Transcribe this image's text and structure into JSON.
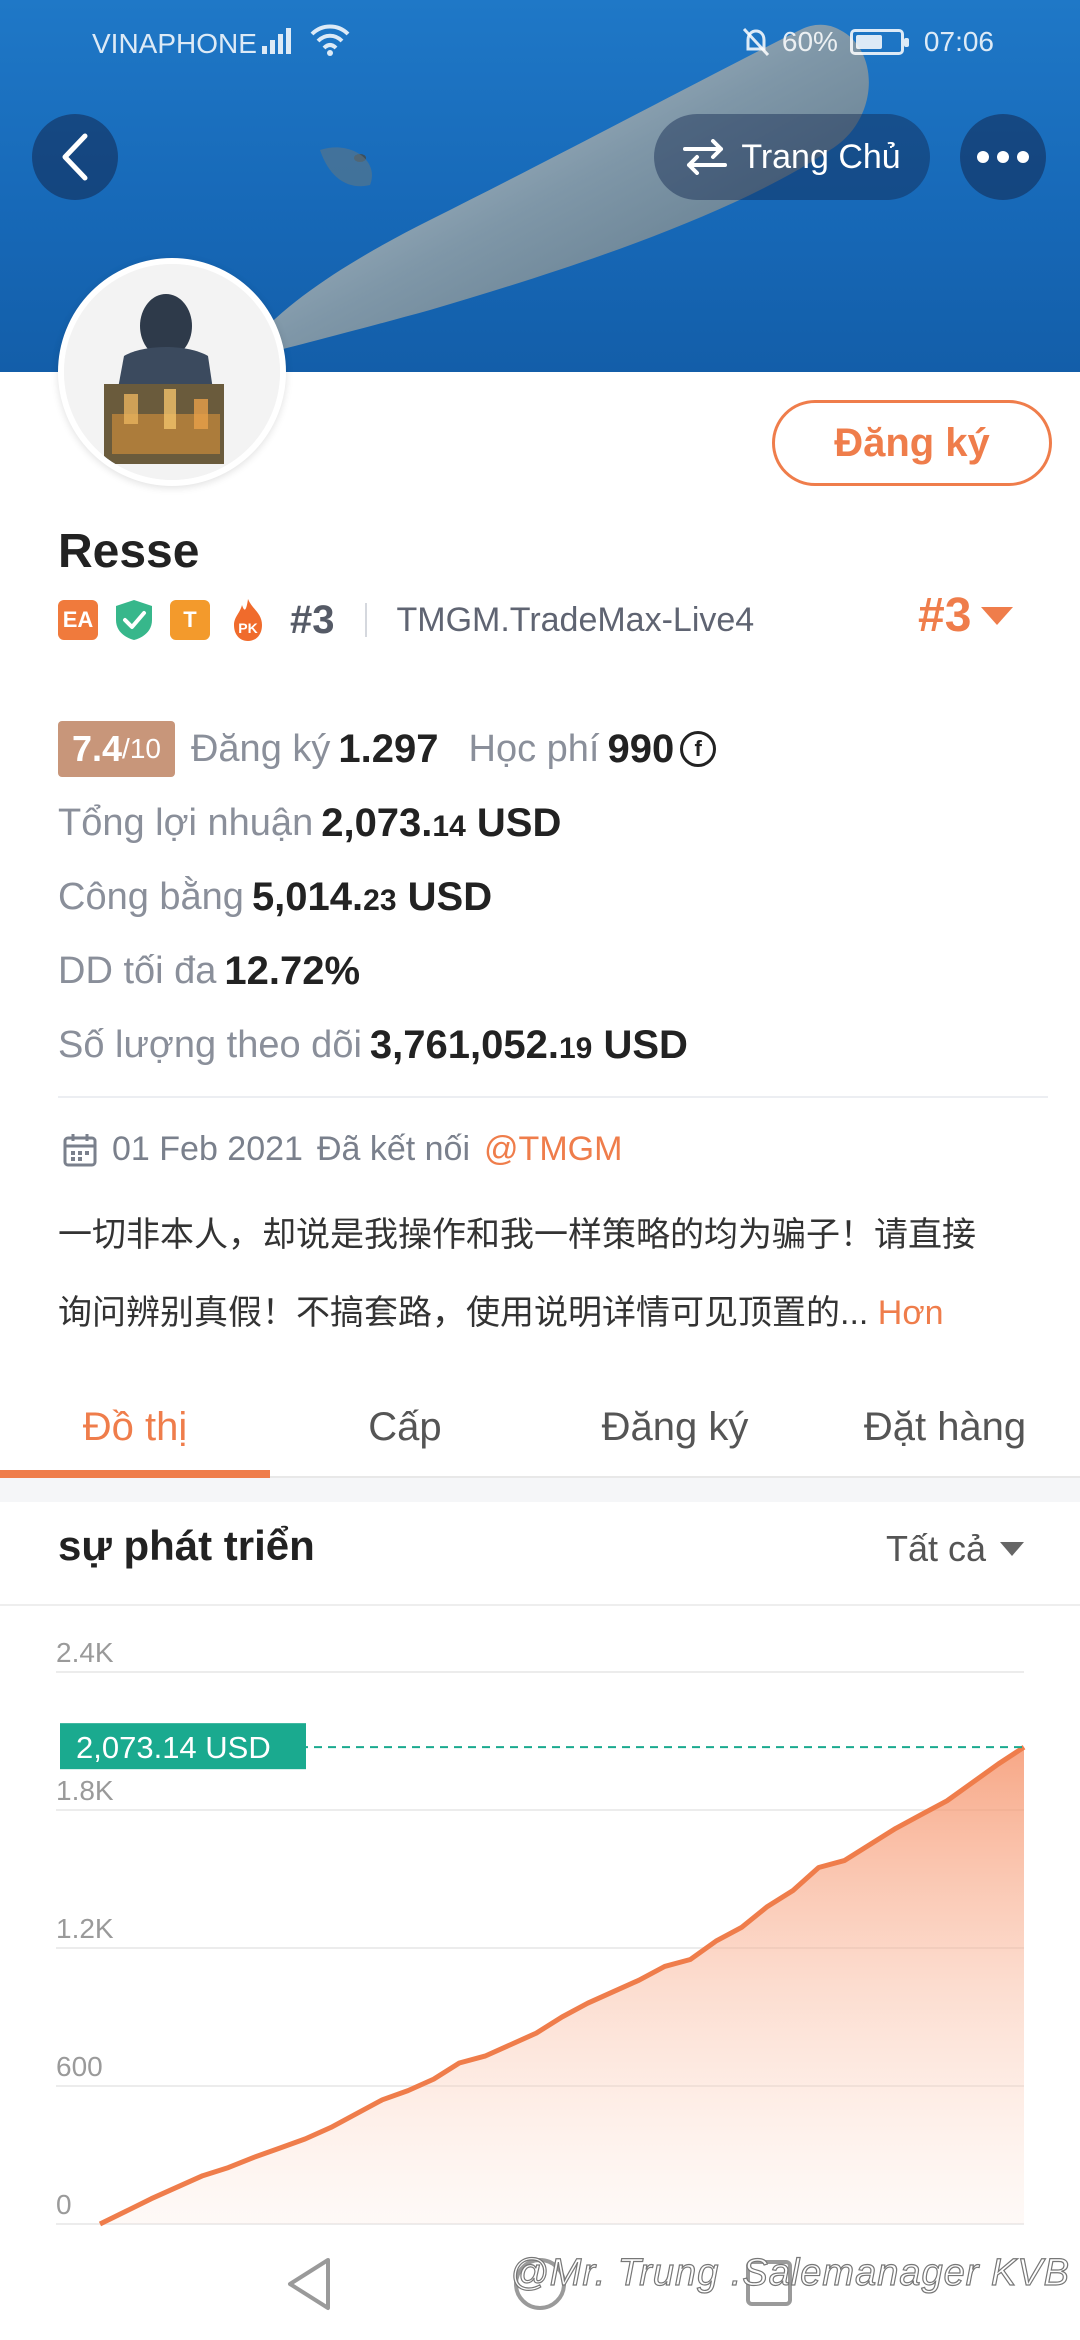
{
  "status_bar": {
    "carrier": "VINAPHONE",
    "battery": "60%",
    "time": "07:06"
  },
  "header": {
    "home_label": "Trang Chủ",
    "subscribe_label": "Đăng ký"
  },
  "profile": {
    "name": "Resse",
    "badges": [
      "EA",
      "T",
      "PK"
    ],
    "rank": "#3",
    "server": "TMGM.TradeMax-Live4",
    "rank_right": "#3"
  },
  "stats": {
    "score_main": "7.4",
    "score_suffix": "/10",
    "subscribers_label": "Đăng ký",
    "subscribers_value": "1.297",
    "fee_label": "Học phí",
    "fee_value": "990",
    "fee_currency_symbol": "f",
    "profit_label": "Tổng lợi nhuận",
    "profit_int": "2,073.",
    "profit_dec": "14",
    "profit_unit": "USD",
    "equity_label": "Công bằng",
    "equity_int": "5,014.",
    "equity_dec": "23",
    "equity_unit": "USD",
    "dd_label": "DD tối đa",
    "dd_value": "12.72%",
    "follow_label": "Số lượng theo dõi",
    "follow_int": "3,761,052.",
    "follow_dec": "19",
    "follow_unit": "USD"
  },
  "connection": {
    "date": "01 Feb 2021",
    "text": "Đã kết nối",
    "handle": "@TMGM"
  },
  "bio": {
    "line1": "一切非本人，却说是我操作和我一样策略的均为骗子！请直接",
    "line2": "询问辨别真假！不搞套路，使用说明详情可见顶置的...",
    "more": "Hơn"
  },
  "tabs": [
    "Đồ thị",
    "Cấp",
    "Đăng ký",
    "Đặt hàng"
  ],
  "chart_section": {
    "title": "sự phát triển",
    "filter": "Tất cả"
  },
  "colors": {
    "accent": "#ef7d4b",
    "teal": "#1aaa8f",
    "banner": "#1769b8"
  },
  "chart_data": {
    "type": "area",
    "ylim": [
      0,
      2400
    ],
    "yticks": [
      "2.4K",
      "1.8K",
      "1.2K",
      "600",
      "0"
    ],
    "ytick_values": [
      2400,
      1800,
      1200,
      600,
      0
    ],
    "current_label": "2,073.14 USD",
    "current_value": 2073.14,
    "series": [
      {
        "values": [
          0,
          55,
          110,
          160,
          210,
          245,
          290,
          330,
          370,
          420,
          480,
          540,
          580,
          630,
          700,
          730,
          780,
          830,
          900,
          960,
          1010,
          1060,
          1120,
          1150,
          1230,
          1290,
          1380,
          1450,
          1550,
          1580,
          1650,
          1720,
          1780,
          1840,
          1920,
          2000,
          2073.14
        ]
      }
    ]
  },
  "watermark": "@Mr. Trung .Salemanager KVB"
}
